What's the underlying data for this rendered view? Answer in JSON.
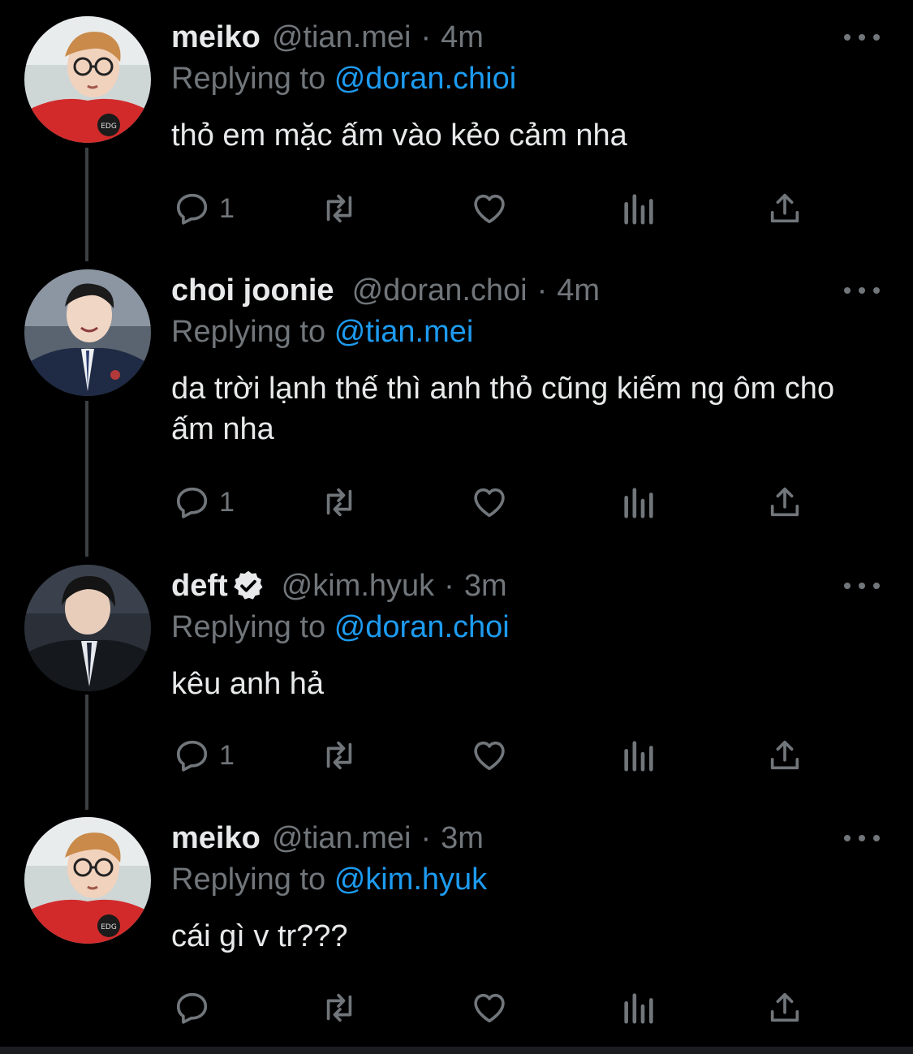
{
  "colors": {
    "background": "#000000",
    "text": "#e7e9ea",
    "secondary": "#71767b",
    "mention": "#1d9bf0",
    "thread_line": "#3b4043"
  },
  "tweets": [
    {
      "name": "meiko",
      "handle": "@tian.mei",
      "separator": "·",
      "time": "4m",
      "verified": false,
      "reply_prefix": "Replying to",
      "reply_to": "@doran.chioi",
      "text": "thỏ em mặc ấm vào kẻo cảm nha",
      "reply_count": "1",
      "avatar_icon": "avatar-red-jersey-glasses"
    },
    {
      "name": "choi joonie",
      "handle": "@doran.choi",
      "separator": "·",
      "time": "4m",
      "verified": false,
      "reply_prefix": "Replying to",
      "reply_to": "@tian.mei",
      "text": "da trời lạnh thế thì anh thỏ cũng kiếm ng ôm cho ấm nha",
      "reply_count": "1",
      "avatar_icon": "avatar-suit"
    },
    {
      "name": "deft",
      "handle": "@kim.hyuk",
      "separator": "·",
      "time": "3m",
      "verified": true,
      "reply_prefix": "Replying to",
      "reply_to": "@doran.choi",
      "text": "kêu anh hả",
      "reply_count": "1",
      "avatar_icon": "avatar-suit-dark"
    },
    {
      "name": "meiko",
      "handle": "@tian.mei",
      "separator": "·",
      "time": "3m",
      "verified": false,
      "reply_prefix": "Replying to",
      "reply_to": "@kim.hyuk",
      "text": "cái gì v tr???",
      "reply_count": "",
      "avatar_icon": "avatar-red-jersey-glasses"
    }
  ]
}
